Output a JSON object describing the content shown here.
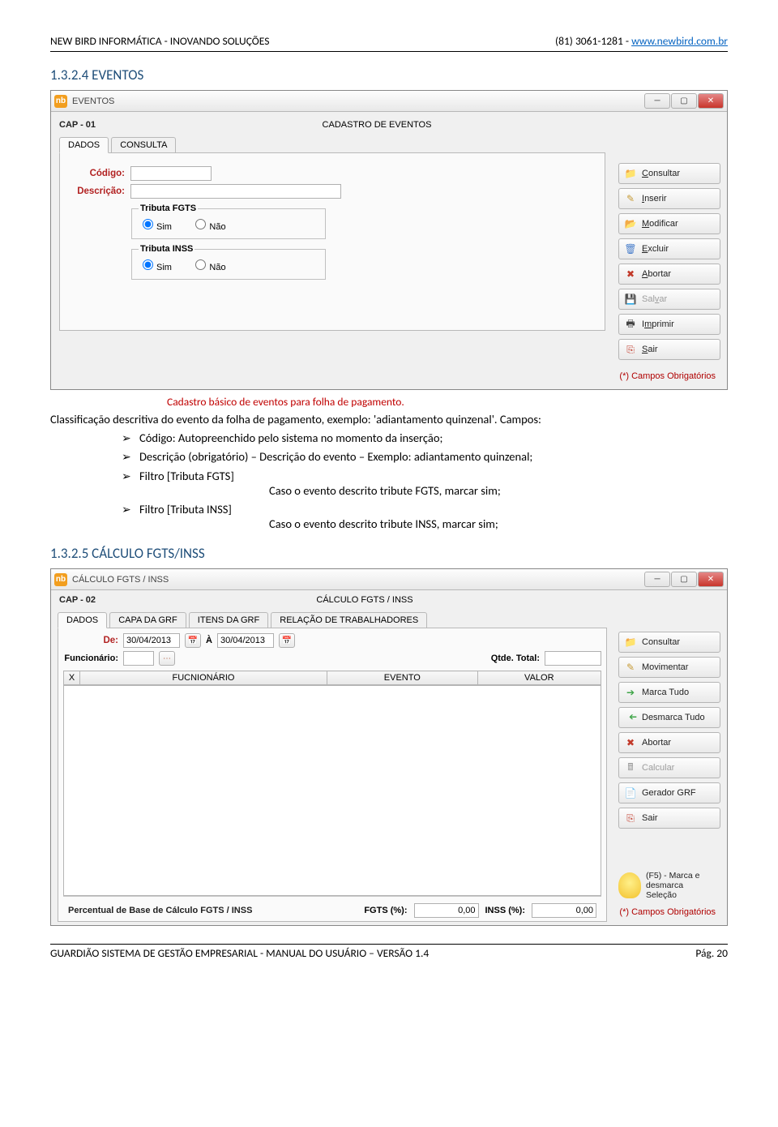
{
  "page": {
    "header_left": "NEW BIRD INFORMÁTICA - INOVANDO SOLUÇÕES",
    "header_right_phone": "(81) 3061-1281 - ",
    "header_right_url": "www.newbird.com.br",
    "footer_left": "GUARDIÃO SISTEMA DE GESTÃO EMPRESARIAL - MANUAL DO USUÁRIO – VERSÃO 1.4",
    "footer_right": "Pág. 20"
  },
  "section1": {
    "number": "1.3.2.4 EVENTOS",
    "caption": "Cadastro básico de eventos para folha de pagamento.",
    "intro": "Classificação descritiva do evento da folha de pagamento, exemplo: 'adiantamento quinzenal'. Campos:",
    "bullets": [
      "Código: Autopreenchido pelo sistema no momento da inserção;",
      "Descrição (obrigatório) – Descrição do evento – Exemplo: adiantamento quinzenal;",
      "Filtro [Tributa FGTS]",
      "Filtro [Tributa INSS]"
    ],
    "subs": {
      "fgts": "Caso o evento descrito tribute FGTS, marcar sim;",
      "inss": "Caso o evento descrito tribute INSS, marcar sim;"
    }
  },
  "section2": {
    "number": "1.3.2.5 CÁLCULO FGTS/INSS"
  },
  "win1": {
    "title": "EVENTOS",
    "cap": "CAP - 01",
    "formtitle": "CADASTRO DE EVENTOS",
    "tabs": [
      "DADOS",
      "CONSULTA"
    ],
    "labels": {
      "codigo": "Código:",
      "descricao": "Descrição:"
    },
    "groups": {
      "fgts": {
        "legend": "Tributa FGTS",
        "sim": "Sim",
        "nao": "Não"
      },
      "inss": {
        "legend": "Tributa INSS",
        "sim": "Sim",
        "nao": "Não"
      }
    },
    "buttons": [
      "Consultar",
      "Inserir",
      "Modificar",
      "Excluir",
      "Abortar",
      "Salvar",
      "Imprimir",
      "Sair"
    ],
    "underline_chars": [
      "C",
      "I",
      "M",
      "E",
      "A",
      "v",
      "m",
      "S"
    ],
    "oblig": "(*) Campos Obrigatórios"
  },
  "win2": {
    "title": "CÁLCULO FGTS / INSS",
    "cap": "CAP - 02",
    "formtitle": "CÁLCULO FGTS / INSS",
    "tabs": [
      "DADOS",
      "CAPA DA GRF",
      "ITENS DA GRF",
      "RELAÇÃO DE TRABALHADORES"
    ],
    "labels": {
      "de": "De:",
      "a": "À",
      "func": "Funcionário:",
      "qtde": "Qtde. Total:"
    },
    "date_from": "30/04/2013",
    "date_to": "30/04/2013",
    "table_headers": [
      "X",
      "FUCNIONÁRIO",
      "EVENTO",
      "VALOR"
    ],
    "footer": {
      "label": "Percentual de Base de Cálculo FGTS / INSS",
      "fgts_label": "FGTS (%):",
      "fgts_val": "0,00",
      "inss_label": "INSS (%):",
      "inss_val": "0,00"
    },
    "buttons": [
      "Consultar",
      "Movimentar",
      "Marca Tudo",
      "Desmarca Tudo",
      "Abortar",
      "Calcular",
      "Gerador GRF",
      "Sair"
    ],
    "hint": "(F5) - Marca e desmarca Seleção",
    "oblig": "(*) Campos Obrigatórios"
  }
}
